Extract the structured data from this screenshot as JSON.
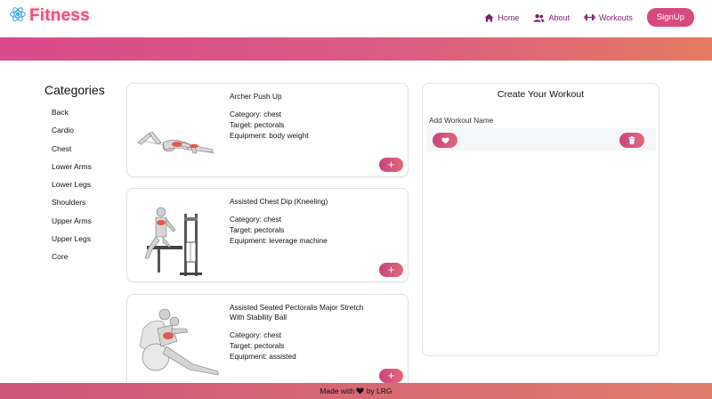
{
  "brand": {
    "name": "Fitness",
    "logo_icon": "react-atom-icon",
    "color": "#e2577f"
  },
  "nav": {
    "items": [
      {
        "label": "Home",
        "icon": "home-icon"
      },
      {
        "label": "About",
        "icon": "users-icon"
      },
      {
        "label": "Workouts",
        "icon": "dumbbell-icon"
      }
    ],
    "signup_label": "SignUp"
  },
  "categories": {
    "title": "Categories",
    "items": [
      "Back",
      "Cardio",
      "Chest",
      "Lower Arms",
      "Lower Legs",
      "Shoulders",
      "Upper Arms",
      "Upper Legs",
      "Core"
    ]
  },
  "exercises": [
    {
      "name": "Archer Push Up",
      "category": "Category: chest",
      "target": "Target: pectorals",
      "equipment": "Equipment: body weight",
      "add_label": "+"
    },
    {
      "name": "Assisted Chest Dip (Kneeling)",
      "category": "Category: chest",
      "target": "Target: pectorals",
      "equipment": "Equipment: leverage machine",
      "add_label": "+"
    },
    {
      "name": "Assisted Seated Pectoralis Major Stretch With Stability Ball",
      "category": "Category: chest",
      "target": "Target: pectorals",
      "equipment": "Equipment: assisted",
      "add_label": "+"
    }
  ],
  "workout_panel": {
    "title": "Create Your Workout",
    "name_placeholder": "Add Workout Name",
    "save_icon": "heart-icon",
    "delete_icon": "trash-icon"
  },
  "footer": {
    "text_before": "Made with",
    "text_after": "by LRG",
    "icon": "heart-icon"
  },
  "colors": {
    "accent": "#d8497f",
    "nav_text": "#7a1f74",
    "gradient_start": "#d94a8a",
    "gradient_end": "#e57a61"
  }
}
